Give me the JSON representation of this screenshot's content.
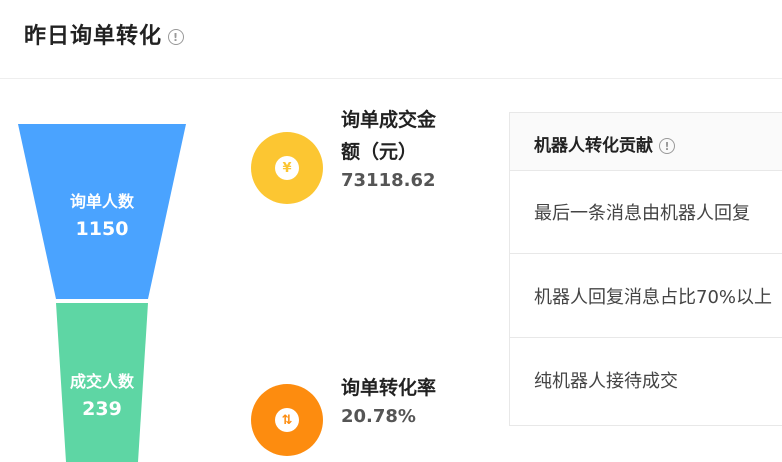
{
  "header": {
    "title": "昨日询单转化",
    "info_icon": "!"
  },
  "funnel": {
    "stages": [
      {
        "name": "询单人数",
        "value": "1150",
        "color": "#4aa3ff"
      },
      {
        "name": "成交人数",
        "value": "239",
        "color": "#5ed6a4"
      }
    ]
  },
  "metrics": [
    {
      "icon": "yen-icon",
      "icon_glyph": "¥",
      "color": "#fcc632",
      "label": "询单成交金额（元）",
      "value": "73118.62"
    },
    {
      "icon": "up-down-arrows-icon",
      "icon_glyph": "⇅",
      "color": "#fd8c0f",
      "label": "询单转化率",
      "value": "20.78%"
    }
  ],
  "contribution": {
    "title": "机器人转化贡献",
    "info_icon": "!",
    "rows": [
      "最后一条消息由机器人回复",
      "机器人回复消息占比70%以上",
      "纯机器人接待成交"
    ]
  }
}
